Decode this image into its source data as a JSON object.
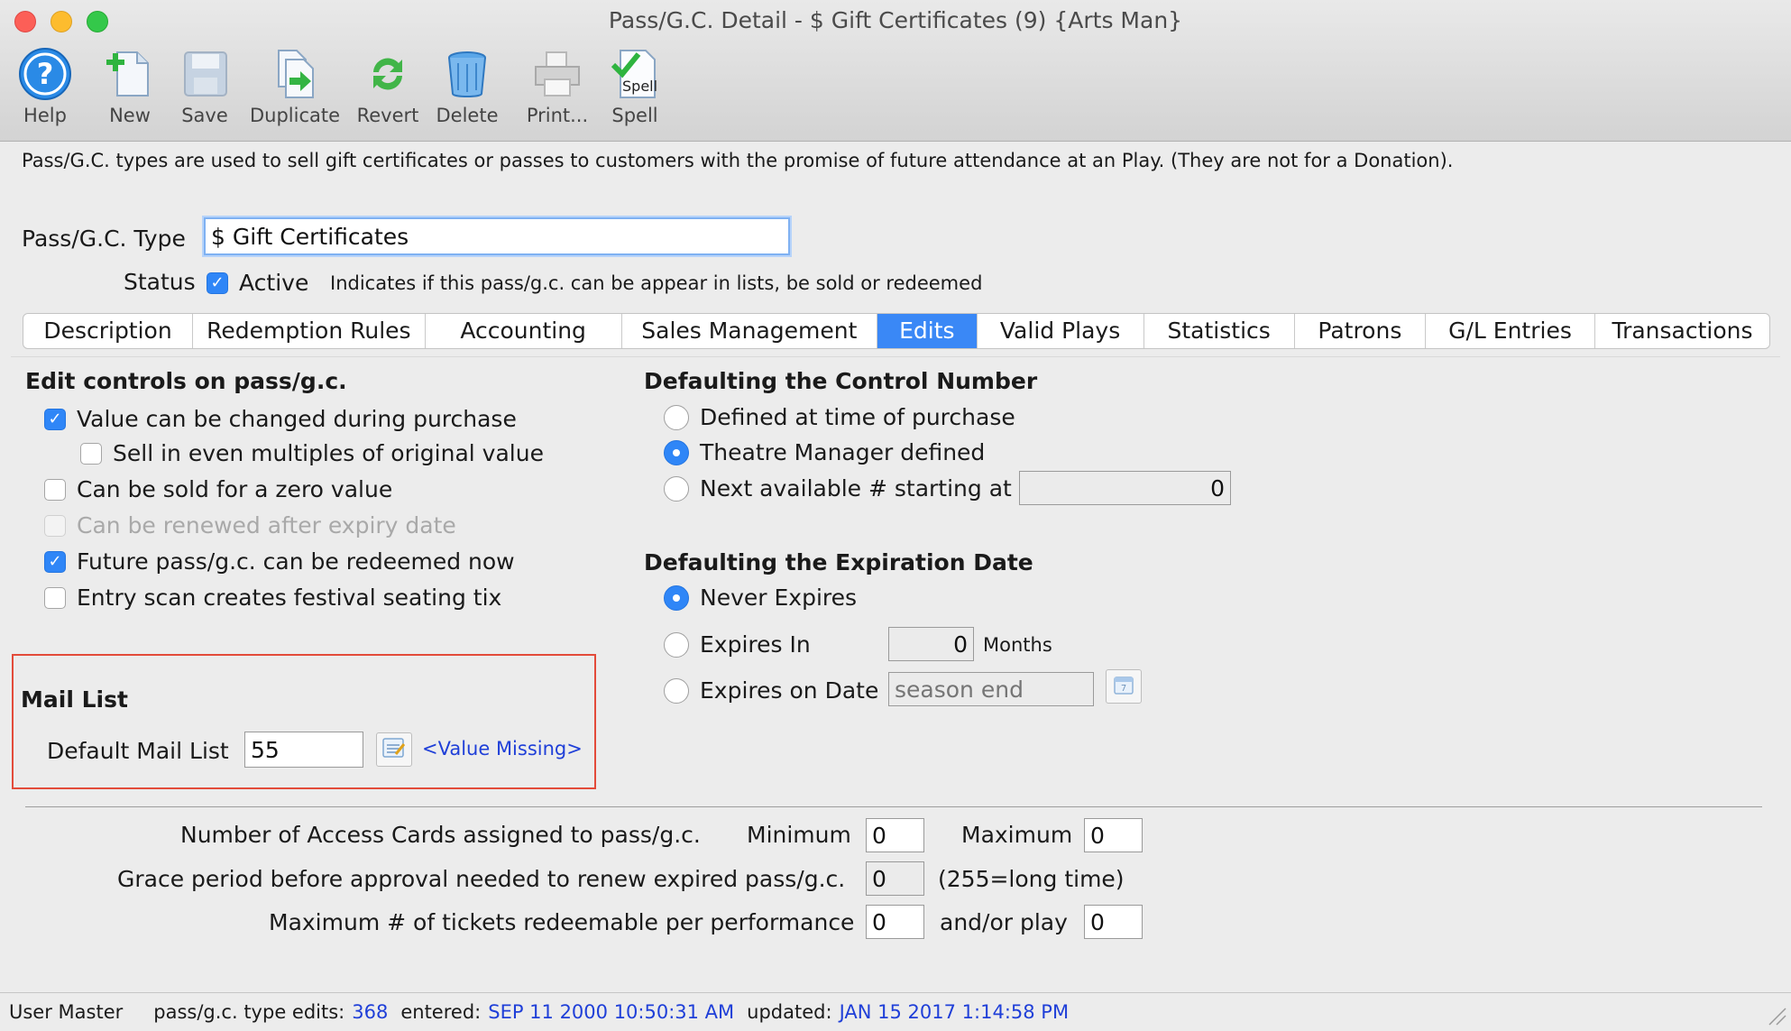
{
  "window": {
    "title": "Pass/G.C. Detail - $ Gift Certificates (9) {Arts Man}"
  },
  "toolbar": {
    "items": [
      {
        "label": "Help",
        "icon": "help-icon"
      },
      {
        "label": "New",
        "icon": "new-document-icon"
      },
      {
        "label": "Save",
        "icon": "save-disk-icon"
      },
      {
        "label": "Duplicate",
        "icon": "duplicate-icon"
      },
      {
        "label": "Revert",
        "icon": "revert-icon"
      },
      {
        "label": "Delete",
        "icon": "trash-can-icon"
      },
      {
        "label": "Print...",
        "icon": "printer-icon"
      },
      {
        "label": "Spell",
        "icon": "spell-check-icon"
      }
    ],
    "spell_icon_text": "Spell"
  },
  "description": "Pass/G.C. types are used to sell gift certificates or passes to customers with the promise of future attendance at an Play.  (They are not for a Donation).",
  "type_field": {
    "label": "Pass/G.C. Type",
    "value": "$ Gift Certificates"
  },
  "status": {
    "label": "Status",
    "active_label": "Active",
    "active": true,
    "hint": "Indicates if this pass/g.c. can be appear in lists, be sold or redeemed"
  },
  "tabs": [
    {
      "label": "Description",
      "active": false
    },
    {
      "label": "Redemption Rules",
      "active": false
    },
    {
      "label": "Accounting",
      "active": false
    },
    {
      "label": "Sales Management",
      "active": false
    },
    {
      "label": "Edits",
      "active": true
    },
    {
      "label": "Valid Plays",
      "active": false
    },
    {
      "label": "Statistics",
      "active": false
    },
    {
      "label": "Patrons",
      "active": false
    },
    {
      "label": "G/L Entries",
      "active": false
    },
    {
      "label": "Transactions",
      "active": false
    }
  ],
  "edit_controls": {
    "heading": "Edit controls on pass/g.c.",
    "items": [
      {
        "label": "Value can be changed during purchase",
        "checked": true,
        "enabled": true
      },
      {
        "label": "Sell in even multiples of original value",
        "checked": false,
        "enabled": true
      },
      {
        "label": "Can be sold for a zero value",
        "checked": false,
        "enabled": true
      },
      {
        "label": "Can be renewed after expiry date",
        "checked": false,
        "enabled": false
      },
      {
        "label": "Future pass/g.c. can be redeemed now",
        "checked": true,
        "enabled": true
      },
      {
        "label": "Entry scan creates festival seating tix",
        "checked": false,
        "enabled": true
      }
    ]
  },
  "control_number": {
    "heading": "Defaulting the Control Number",
    "options": [
      {
        "label": "Defined at time of purchase",
        "selected": false
      },
      {
        "label": "Theatre Manager defined",
        "selected": true
      },
      {
        "label": "Next available # starting at",
        "selected": false
      }
    ],
    "starting_value": "0"
  },
  "expiration": {
    "heading": "Defaulting the Expiration Date",
    "options": [
      {
        "label": "Never Expires",
        "selected": true
      },
      {
        "label": "Expires In",
        "selected": false
      },
      {
        "label": "Expires on Date",
        "selected": false
      }
    ],
    "months_value": "0",
    "months_label": "Months",
    "date_placeholder": "season end"
  },
  "mail_list": {
    "heading": "Mail List",
    "label": "Default Mail List",
    "value": "55",
    "lookup_text": "<Value Missing>"
  },
  "access_cards": {
    "label": "Number of Access Cards assigned to pass/g.c.",
    "min_label": "Minimum",
    "min_value": "0",
    "max_label": "Maximum",
    "max_value": "0"
  },
  "grace_period": {
    "label": "Grace period before approval needed to renew expired pass/g.c.",
    "value": "0",
    "note": "(255=long time)"
  },
  "max_tickets": {
    "label": "Maximum # of tickets redeemable per performance",
    "value": "0",
    "play_label": "and/or play",
    "play_value": "0"
  },
  "statusbar": {
    "user": "User Master",
    "edits_label": "pass/g.c. type edits:",
    "edits_value": "368",
    "entered_label": "entered:",
    "entered_value": "SEP 11 2000 10:50:31 AM",
    "updated_label": "updated:",
    "updated_value": "JAN 15 2017 1:14:58 PM"
  },
  "colors": {
    "accent": "#3a88f6",
    "highlight_box": "#e34b3a",
    "link": "#1f3fd8"
  }
}
